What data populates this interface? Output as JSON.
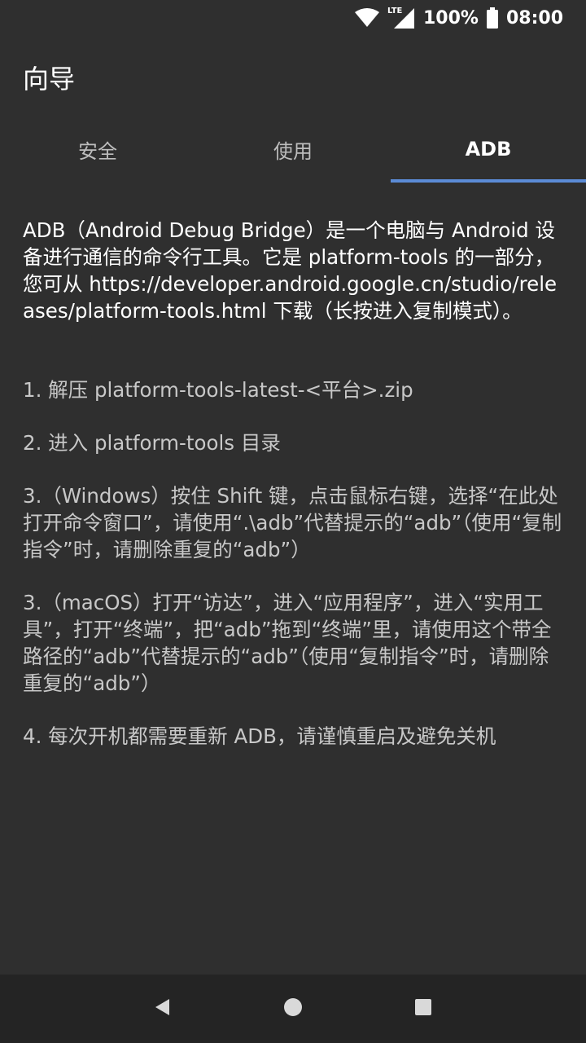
{
  "status_bar": {
    "battery_text": "100%",
    "time": "08:00",
    "network_label": "LTE"
  },
  "app_bar": {
    "title": "向导"
  },
  "tabs": [
    {
      "label": "安全",
      "active": false
    },
    {
      "label": "使用",
      "active": false
    },
    {
      "label": "ADB",
      "active": true
    }
  ],
  "content": {
    "intro": "ADB（Android Debug Bridge）是一个电脑与 Android 设备进行通信的命令行工具。它是 platform-tools 的一部分，您可从 https://developer.android.google.cn/studio/releases/platform-tools.html 下载（长按进入复制模式）。",
    "steps": [
      "1. 解压 platform-tools-latest-<平台>.zip",
      "2. 进入 platform-tools 目录",
      "3.（Windows）按住 Shift 键，点击鼠标右键，选择“在此处打开命令窗口”，请使用“.\\adb”代替提示的“adb”（使用“复制指令”时，请删除重复的“adb”）",
      "3.（macOS）打开“访达”，进入“应用程序”，进入“实用工具”，打开“终端”，把“adb”拖到“终端”里，请使用这个带全路径的“adb”代替提示的“adb”（使用“复制指令”时，请删除重复的“adb”）",
      "4. 每次开机都需要重新 ADB，请谨慎重启及避免关机"
    ]
  },
  "colors": {
    "background": "#2f2f2f",
    "accent": "#5b8bd6",
    "nav_bar": "#242424"
  },
  "icons": {
    "wifi": "wifi-icon",
    "signal": "signal-icon",
    "battery": "battery-icon",
    "back": "back-icon",
    "home": "home-icon",
    "recents": "recents-icon"
  }
}
